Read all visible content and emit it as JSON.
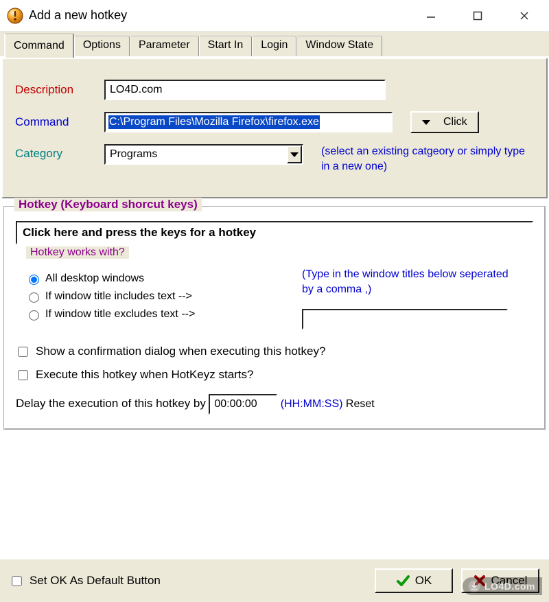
{
  "window": {
    "title": "Add a new hotkey"
  },
  "tabs": {
    "items": [
      "Command",
      "Options",
      "Parameter",
      "Start In",
      "Login",
      "Window State"
    ],
    "activeIndex": 0
  },
  "command_panel": {
    "labels": {
      "description": "Description",
      "command": "Command",
      "category": "Category"
    },
    "description_value": "LO4D.com",
    "command_value": "C:\\Program Files\\Mozilla Firefox\\firefox.exe",
    "click_button": "Click",
    "category_value": "Programs",
    "category_hint": "(select an existing catgeory or simply type in a new one)"
  },
  "hotkey_panel": {
    "legend": "Hotkey (Keyboard shorcut keys)",
    "hotkey_input_value": "Click here and press the keys for a hotkey",
    "works_with_legend": "Hotkey works with?",
    "radios": {
      "all": "All desktop windows",
      "includes": "If window title includes text -->",
      "excludes": "If window title excludes text -->"
    },
    "window_titles_hint": "(Type in the window titles below seperated by a comma ,)",
    "window_titles_value": "",
    "checks": {
      "confirm": "Show a confirmation dialog when executing this hotkey?",
      "on_start": "Execute this hotkey when HotKeyz starts?"
    },
    "delay": {
      "label": "Delay the execution of this hotkey by",
      "value": "00:00:00",
      "format": "(HH:MM:SS)",
      "reset": "Reset"
    }
  },
  "bottom": {
    "set_default_label": "Set OK As Default Button",
    "ok": "OK",
    "cancel": "Cancel"
  },
  "watermark": "LO4D.com"
}
